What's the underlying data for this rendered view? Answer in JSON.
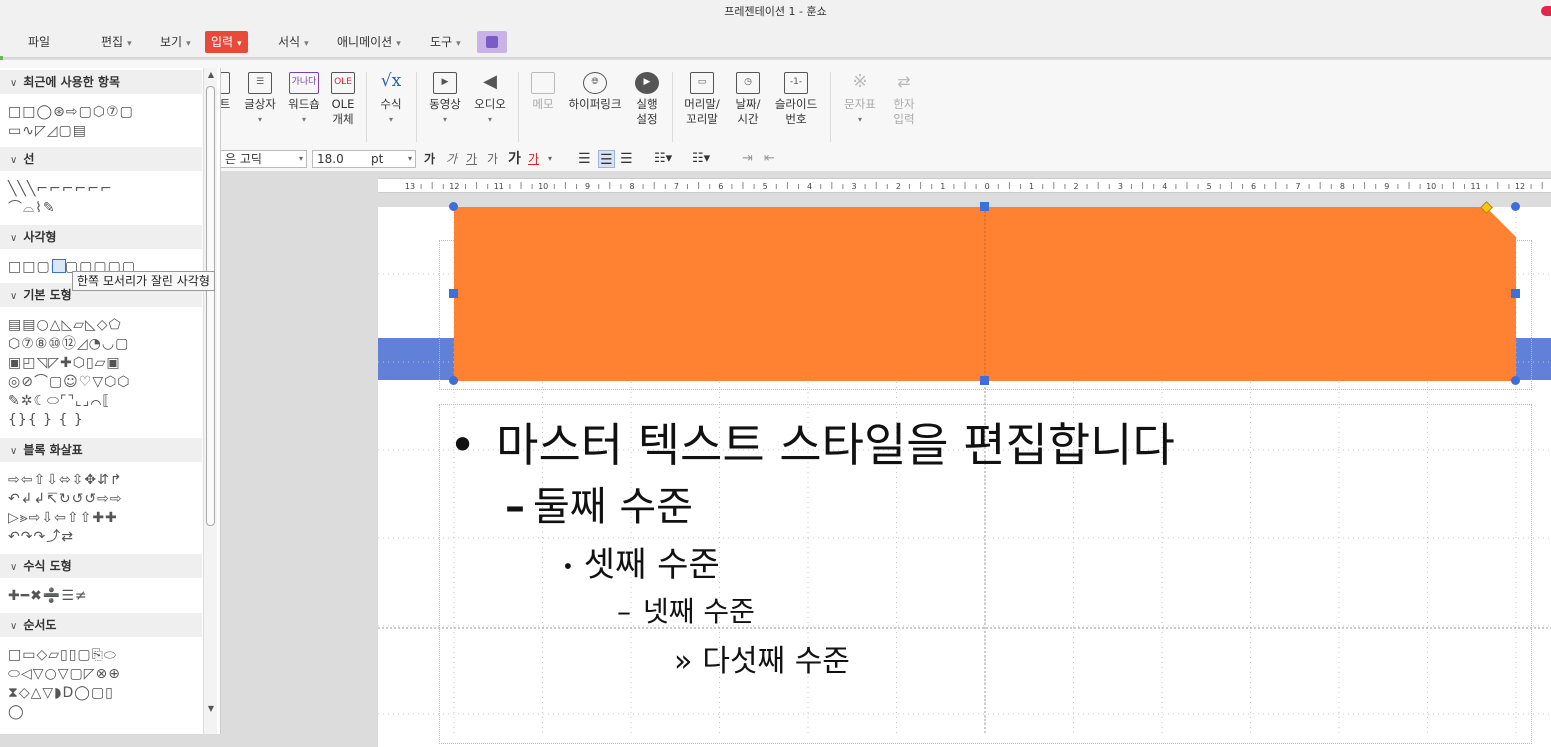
{
  "window": {
    "title": "프레젠테이션 1 - 훈쇼"
  },
  "menubar": {
    "items": [
      {
        "label": "파일"
      },
      {
        "label": "편집"
      },
      {
        "label": "보기"
      },
      {
        "label": "입력",
        "active": true
      },
      {
        "label": "서식"
      },
      {
        "label": "애니메이션"
      },
      {
        "label": "도구"
      }
    ]
  },
  "ribbon": {
    "items": [
      {
        "label": "트",
        "icon": "text-box-icon"
      },
      {
        "label": "글상자",
        "icon": "textbox-icon"
      },
      {
        "label": "워드숍",
        "icon": "wordart-icon",
        "icon_text": "가나다"
      },
      {
        "label": "OLE\n개체",
        "icon": "ole-icon",
        "icon_text": "OLE"
      },
      {
        "label": "수식",
        "icon": "formula-icon",
        "icon_text": "√x"
      },
      {
        "label": "동영상",
        "icon": "video-icon"
      },
      {
        "label": "오디오",
        "icon": "audio-icon"
      },
      {
        "label": "메모",
        "icon": "memo-icon",
        "disabled": true
      },
      {
        "label": "하이퍼링크",
        "icon": "hyperlink-icon"
      },
      {
        "label": "실행\n설정",
        "icon": "action-icon"
      },
      {
        "label": "머리말/\n꼬리말",
        "icon": "header-footer-icon"
      },
      {
        "label": "날짜/\n시간",
        "icon": "datetime-icon"
      },
      {
        "label": "슬라이드\n번호",
        "icon": "slide-number-icon",
        "icon_text": "-1-"
      },
      {
        "label": "문자표",
        "icon": "symbol-icon",
        "disabled": true
      },
      {
        "label": "한자\n입력",
        "icon": "hanja-icon",
        "disabled": true
      }
    ]
  },
  "format": {
    "font": "은 고딕",
    "size": "18.0",
    "unit": "pt"
  },
  "ruler": {
    "labels": [
      "13",
      "12",
      "11",
      "10",
      "9",
      "8",
      "7",
      "6",
      "5",
      "4",
      "3",
      "2",
      "1",
      "0",
      "1",
      "2",
      "3",
      "4",
      "5",
      "6",
      "7",
      "8",
      "9",
      "10",
      "11",
      "12"
    ]
  },
  "slide": {
    "levels": [
      {
        "bullet": "•",
        "text": "마스터 텍스트 스타일을 편집합니다"
      },
      {
        "bullet": "–",
        "text": "둘째 수준"
      },
      {
        "bullet": "•",
        "text": "셋째 수준"
      },
      {
        "bullet": "–",
        "text": "넷째 수준"
      },
      {
        "bullet": "»",
        "text": "다섯째 수준"
      }
    ],
    "colors": {
      "orange": "#ff8132",
      "blue": "#6180d8",
      "handle": "#3e6fd8",
      "adjust": "#f5c518"
    }
  },
  "shapes_panel": {
    "sections": [
      {
        "title": "최근에 사용한 항목",
        "rows": [
          "□□◯⊛⇨▢⬡⑦▢",
          "▭∿◸◿▢▤"
        ]
      },
      {
        "title": "선",
        "rows": [
          "╲╲╲⌐⌐⌐⌐⌐⌐",
          "⌒⌓⌇✎"
        ]
      },
      {
        "title": "사각형",
        "rows": [
          "□□▢▢▢▢▢▢▢"
        ]
      },
      {
        "title": "기본 도형",
        "rows": [
          "▤▤○△◺▱◺◇⬠",
          "⬡⑦⑧⑩⑫◿◔◡▢",
          "▣◰◹◸✚⬡▯▱▣",
          "◎⊘⌒▢☺♡▽⬡⬡",
          "✎✲☾⬭⌜⌝⌞⌟⌒⟦",
          "{}{ } { }"
        ]
      },
      {
        "title": "블록 화살표",
        "rows": [
          "⇨⇦⇧⇩⬄⇳✥⇵↱",
          "↶↲↲↸↻↺↺⇨⇨",
          "▷⪢⇨⇩⇦⇧⇧✚✚",
          "↶↷↷⤴⇄"
        ]
      },
      {
        "title": "수식 도형",
        "rows": [
          "✚━✖➗☰≠"
        ]
      },
      {
        "title": "순서도",
        "rows": [
          "□▭◇▱▯▯▢⎘⬭",
          "⬭◁▽○▽▢◸⊗⊕",
          "⧗◇△▽◗D◯▢▯",
          "◯"
        ]
      }
    ]
  },
  "tooltip": {
    "text": "한쪽 모서리가 잘린 사각형"
  }
}
